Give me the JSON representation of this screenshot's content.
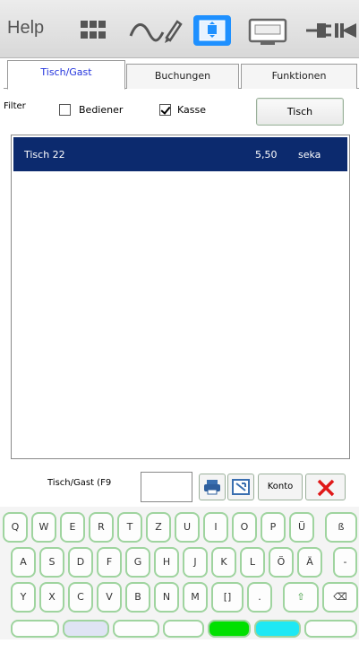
{
  "toolbar": {
    "help_label": "Help",
    "icons": [
      "apps-icon",
      "signature-icon",
      "screen-capture-icon",
      "monitor-icon",
      "plug-icon"
    ],
    "accent": "#1e90ff"
  },
  "tabs": [
    {
      "label": "Tisch/Gast",
      "active": true
    },
    {
      "label": "Buchungen",
      "active": false
    },
    {
      "label": "Funktionen",
      "active": false
    }
  ],
  "filter": {
    "label": "Filter",
    "bediener": {
      "label": "Bediener",
      "checked": false
    },
    "kasse": {
      "label": "Kasse",
      "checked": true
    },
    "tisch_button": "Tisch"
  },
  "list": {
    "rows": [
      {
        "name": "Tisch 22",
        "amount": "5,50",
        "user": "seka",
        "selected": true
      }
    ],
    "selected_color": "#0c2a6e"
  },
  "entry": {
    "label": "Tisch/Gast (F9",
    "value": "",
    "konto_label": "Konto"
  },
  "keyboard": {
    "row1": [
      "Q",
      "W",
      "E",
      "R",
      "T",
      "Z",
      "U",
      "I",
      "O",
      "P",
      "Ü",
      "ß"
    ],
    "row2": [
      "A",
      "S",
      "D",
      "F",
      "G",
      "H",
      "J",
      "K",
      "L",
      "Ö",
      "Ä",
      "-"
    ],
    "row3": [
      "Y",
      "X",
      "C",
      "V",
      "B",
      "N",
      "M",
      "[]",
      ".",
      "⇧",
      "⌫"
    ]
  }
}
